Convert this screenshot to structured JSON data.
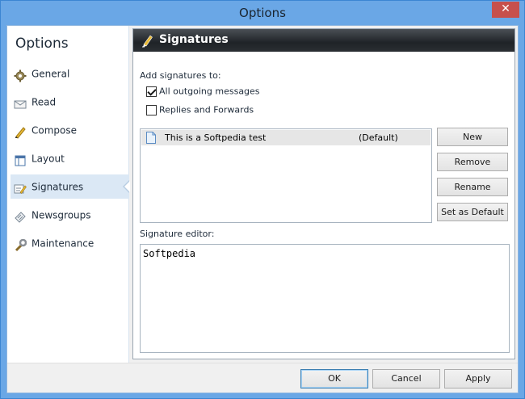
{
  "window": {
    "title": "Options",
    "close_glyph": "✕"
  },
  "sidebar": {
    "title": "Options",
    "items": [
      {
        "label": "General",
        "icon": "gear-icon"
      },
      {
        "label": "Read",
        "icon": "envelope-icon"
      },
      {
        "label": "Compose",
        "icon": "pencil-icon"
      },
      {
        "label": "Layout",
        "icon": "layout-icon"
      },
      {
        "label": "Signatures",
        "icon": "signature-icon",
        "active": true
      },
      {
        "label": "Newsgroups",
        "icon": "newsgroups-icon"
      },
      {
        "label": "Maintenance",
        "icon": "wrench-icon"
      }
    ]
  },
  "panel": {
    "title": "Signatures",
    "add_label": "Add signatures to:",
    "options": [
      {
        "label": "All outgoing messages",
        "checked": true
      },
      {
        "label": "Replies and Forwards",
        "checked": false
      }
    ],
    "signatures": [
      {
        "name": "This is a Softpedia test",
        "status": "(Default)"
      }
    ],
    "buttons": {
      "new": "New",
      "remove": "Remove",
      "rename": "Rename",
      "set_default": "Set as Default"
    },
    "editor_label": "Signature editor:",
    "editor_text": "Softpedia"
  },
  "footer": {
    "ok": "OK",
    "cancel": "Cancel",
    "apply": "Apply"
  },
  "colors": {
    "titlebar": "#6aa7e6",
    "close": "#c7504c",
    "header": "#1f2327",
    "selected_nav": "#dbe8f5"
  }
}
